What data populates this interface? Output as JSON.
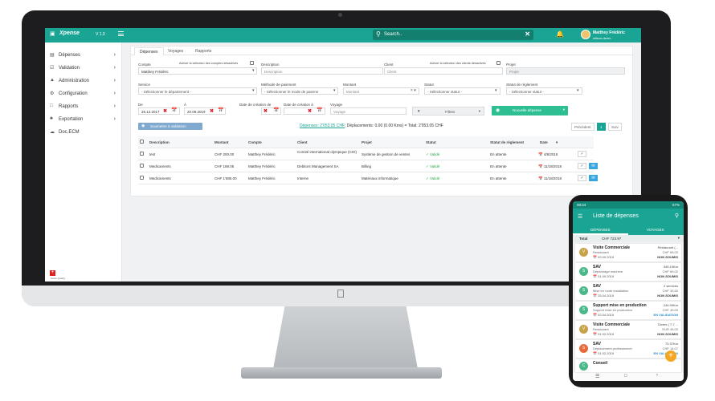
{
  "app": {
    "brand": "Xpense",
    "version": "V 1.0",
    "search_placeholder": "Search..",
    "user_name": "Matthey Frédéric",
    "user_sub": "wilson-demo"
  },
  "sidebar": {
    "items": [
      {
        "label": "Dépenses",
        "icon": "receipt-icon"
      },
      {
        "label": "Validation",
        "icon": "check-square-icon"
      },
      {
        "label": "Administration",
        "icon": "building-icon"
      },
      {
        "label": "Configuration",
        "icon": "gear-icon"
      },
      {
        "label": "Rapports",
        "icon": "document-icon"
      },
      {
        "label": "Exportation",
        "icon": "export-icon"
      },
      {
        "label": "Doc.ECM",
        "icon": "cloud-icon"
      }
    ],
    "footer_logo": "+",
    "footer_text": "Swiss Quality"
  },
  "tabs": [
    "Dépenses",
    "Voyages",
    "Rapports"
  ],
  "filters": {
    "compte_label": "Compte",
    "compte_value": "Matthey Frédéric",
    "compte_check_label": "Activer la sélection des comptes désactivés",
    "description_label": "Description",
    "description_placeholder": "Description",
    "client_label": "Client",
    "client_placeholder": "Client",
    "client_check_label": "Activer la sélection des clients désactivés",
    "projet_label": "Projet",
    "projet_placeholder": "Projet",
    "service_label": "Service",
    "service_value": "- Sélectionner le département -",
    "methode_label": "Méthode de paiement",
    "methode_value": "- Sélectionner le mode de paieme",
    "montant_label": "Montant",
    "montant_placeholder": "Montant",
    "statut_label": "Statut",
    "statut_value": "- Sélectionner statut -",
    "statut_reglement_label": "Statut de règlement",
    "statut_reglement_value": "- Sélectionner statut -",
    "de_label": "De",
    "de_value": "26.12.2017",
    "a_label": "À",
    "a_value": "20.09.2019",
    "date_creation_de_label": "Date de création de",
    "date_creation_a_label": "Date de création à",
    "voyage_label": "Voyage",
    "voyage_placeholder": "Voyage",
    "filter_button": "Filtres",
    "new_button": "Nouvelle dépense"
  },
  "toolbar": {
    "submit_button": "Soumettre à validation",
    "totals_link": "Dépenses: 2'053.05 CHF",
    "totals_rest": "; Déplacements: 0.00 (0.00 Kms) = Total: 2'053.05 CHF",
    "prev": "Précédent",
    "page": "1",
    "next": "Suiv"
  },
  "table": {
    "headers": [
      "Description",
      "Montant",
      "Compte",
      "Client",
      "Projet",
      "Statut",
      "Statut de règlement",
      "Date"
    ],
    "rows": [
      {
        "description": "test",
        "montant": "CHF 200.00",
        "compte": "Matthey Frédéric",
        "client": "Comité international olympique (CIO)",
        "projet": "Système de gestion de ventes",
        "statut": "Validé",
        "reglement": "En attente",
        "date": "4/8/2019"
      },
      {
        "description": "Medicaments",
        "montant": "CHF 168.05",
        "compte": "Matthey Frédéric",
        "client": "Debitors Management SA",
        "projet": "Billing",
        "statut": "Validé",
        "reglement": "En attente",
        "date": "11/18/2018"
      },
      {
        "description": "Medicaments",
        "montant": "CHF 1'685.00",
        "compte": "Matthey Frédéric",
        "client": "Interne",
        "projet": "Matériaux informatique",
        "statut": "Validé",
        "reglement": "En attente",
        "date": "11/18/2018"
      }
    ]
  },
  "phone": {
    "time": "08:24",
    "battery": "57%",
    "title": "Liste de dépenses",
    "tab_left": "DÉPENSES",
    "tab_right": "VOYAGES",
    "total_label": "Total",
    "total_value": "CHF 723.97",
    "cards": [
      {
        "letter": "V",
        "color": "#c8a24a",
        "title": "Visite Commerciale",
        "sub": "Restaurant",
        "date": "02.09.2019",
        "r1": "Restaurant (...",
        "r2": "CHF 65.00",
        "status": "NON SOUMIS",
        "status_color": "#333"
      },
      {
        "letter": "S",
        "color": "#4cb88a",
        "title": "SAV",
        "sub": "Dépannage machine",
        "date": "01.09.2019",
        "r1": "345.10Km",
        "r2": "CHF 69.02",
        "status": "NON SOUMIS",
        "status_color": "#333"
      },
      {
        "letter": "S",
        "color": "#4cb88a",
        "title": "SAV",
        "sub": "Mise en route installation",
        "date": "25.04.2019",
        "r1": "2 services",
        "r2": "CHF 33.50",
        "status": "NON SOUMIS",
        "status_color": "#333"
      },
      {
        "letter": "S",
        "color": "#4cb88a",
        "title": "Support mise en production",
        "sub": "Support mise en production",
        "date": "02.04.2019",
        "r1": "244.99Km",
        "r2": "CHF 49.00",
        "status": "EN VALIDATION",
        "status_color": "#2a8fd0"
      },
      {
        "letter": "V",
        "color": "#c8a24a",
        "title": "Visite Commerciale",
        "sub": "Restaurant",
        "date": "01.02.2019",
        "r1": "Divers ( 7.7 ...",
        "r2": "EUR 45.00",
        "status": "NON SOUMIS",
        "status_color": "#333"
      },
      {
        "letter": "S",
        "color": "#e86a3a",
        "title": "SAV",
        "sub": "Déplacement professionnel",
        "date": "01.02.2019",
        "r1": "70.37Km",
        "r2": "CHF 14.07",
        "status": "EN VALIDATION",
        "status_color": "#2a8fd0"
      },
      {
        "letter": "C",
        "color": "#4cb88a",
        "title": "Conseil",
        "sub": "",
        "date": "",
        "r1": "",
        "r2": "",
        "status": "",
        "status_color": "#333"
      }
    ],
    "fab": "+"
  }
}
